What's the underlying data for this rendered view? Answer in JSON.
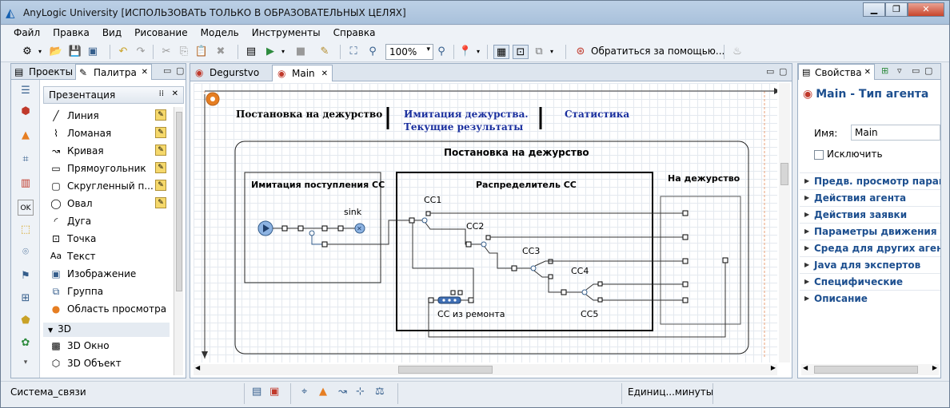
{
  "window": {
    "title": "AnyLogic University [ИСПОЛЬЗОВАТЬ ТОЛЬКО В ОБРАЗОВАТЕЛЬНЫХ ЦЕЛЯХ]"
  },
  "menu": [
    "Файл",
    "Правка",
    "Вид",
    "Рисование",
    "Модель",
    "Инструменты",
    "Справка"
  ],
  "toolbar": {
    "zoom": "100%",
    "help_label": "Обратиться за помощью..."
  },
  "left_panel": {
    "tabs": [
      "Проекты",
      "Палитра"
    ],
    "palette_header": "Презентация",
    "items": [
      "Линия",
      "Ломаная",
      "Кривая",
      "Прямоугольник",
      "Скругленный п...",
      "Овал",
      "Дуга",
      "Точка",
      "Текст",
      "Изображение",
      "Группа",
      "Область просмотра"
    ],
    "section_3d": "3D",
    "items_3d": [
      "3D Окно",
      "3D Объект"
    ]
  },
  "editor": {
    "tabs": [
      "Degurstvo",
      "Main"
    ],
    "nav_labels": [
      "Постановка на дежурство",
      "Имитация дежурства.",
      "Текущие результаты",
      "Статистика"
    ],
    "outer_title": "Постановка на дежурство",
    "sub_left_title": "Имитация поступления СС",
    "sink_label": "sink",
    "center_title": "Распределитель СС",
    "right_title": "На дежурство",
    "cc_labels": [
      "СС1",
      "СС2",
      "СС3",
      "СС4",
      "СС5"
    ],
    "repair_label": "СС из ремонта"
  },
  "right_panel": {
    "tab": "Свойства",
    "title": "Main - Тип агента",
    "name_label": "Имя:",
    "name_value": "Main",
    "exclude_label": "Исключить",
    "sections": [
      "Предв. просмотр параметров",
      "Действия агента",
      "Действия заявки",
      "Параметры движения",
      "Среда для других агентов",
      "Java для экспертов",
      "Специфические",
      "Описание"
    ]
  },
  "status": {
    "left": "Система_связи",
    "right": "Единиц...минуты"
  },
  "colors": {
    "accent": "#1d4f8f",
    "link_text": "#1a2f9e",
    "icon_red": "#c0392b"
  }
}
